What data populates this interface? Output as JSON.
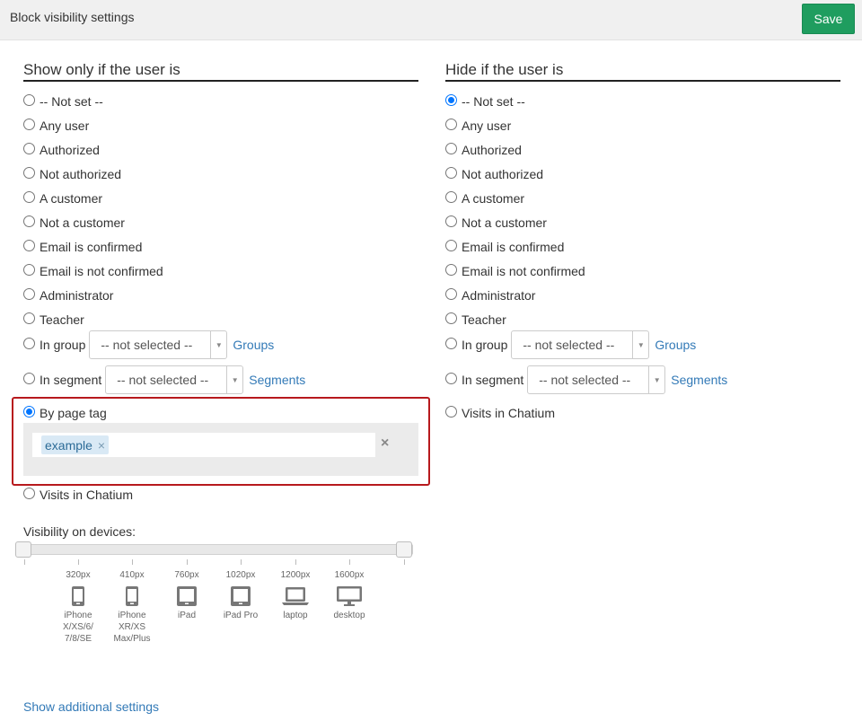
{
  "header": {
    "title": "Block visibility settings",
    "save_label": "Save"
  },
  "left": {
    "heading": "Show only if the user is",
    "options": [
      "-- Not set --",
      "Any user",
      "Authorized",
      "Not authorized",
      "A customer",
      "Not a customer",
      "Email is confirmed",
      "Email is not confirmed",
      "Administrator",
      "Teacher"
    ],
    "group_label": "In group",
    "group_select": "-- not selected --",
    "group_link": "Groups",
    "segment_label": "In segment",
    "segment_select": "-- not selected --",
    "segment_link": "Segments",
    "page_tag_label": "By page tag",
    "page_tag_value": "example",
    "chip_remove": "×",
    "clear": "×",
    "visits_label": "Visits in Chatium",
    "selected": "By page tag"
  },
  "right": {
    "heading": "Hide if the user is",
    "options": [
      "-- Not set --",
      "Any user",
      "Authorized",
      "Not authorized",
      "A customer",
      "Not a customer",
      "Email is confirmed",
      "Email is not confirmed",
      "Administrator",
      "Teacher"
    ],
    "group_label": "In group",
    "group_select": "-- not selected --",
    "group_link": "Groups",
    "segment_label": "In segment",
    "segment_select": "-- not selected --",
    "segment_link": "Segments",
    "visits_label": "Visits in Chatium",
    "selected": "-- Not set --"
  },
  "devices": {
    "label": "Visibility on devices:",
    "items": [
      {
        "px": "320px",
        "name": [
          "iPhone",
          "X/XS/6/",
          "7/8/SE"
        ],
        "icon": "phone-icon"
      },
      {
        "px": "410px",
        "name": [
          "iPhone",
          "XR/XS",
          "Max/Plus"
        ],
        "icon": "phone-icon"
      },
      {
        "px": "760px",
        "name": [
          "iPad"
        ],
        "icon": "tablet-icon"
      },
      {
        "px": "1020px",
        "name": [
          "iPad Pro"
        ],
        "icon": "tablet-icon"
      },
      {
        "px": "1200px",
        "name": [
          "laptop"
        ],
        "icon": "laptop-icon"
      },
      {
        "px": "1600px",
        "name": [
          "desktop"
        ],
        "icon": "desktop-icon"
      }
    ]
  },
  "footer": {
    "show_more": "Show additional settings"
  },
  "colors": {
    "save": "#1f9d5f",
    "link": "#337ab7",
    "highlight": "#b7191d",
    "radio_checked": "#0075ff"
  }
}
